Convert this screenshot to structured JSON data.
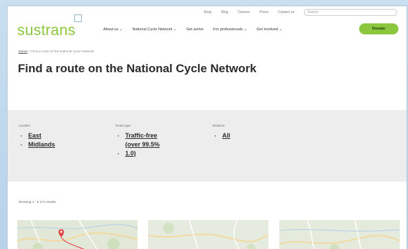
{
  "utility": {
    "links": [
      "Shop",
      "Blog",
      "Careers",
      "Press",
      "Contact us"
    ],
    "search_placeholder": "Search"
  },
  "header": {
    "logo_text": "sustrans",
    "nav": [
      "About us ⌄",
      "National Cycle Network ⌄",
      "Get active",
      "For professionals ⌄",
      "Get involved ⌄"
    ],
    "donate_label": "Donate"
  },
  "breadcrumb": {
    "home": "Home",
    "separator": ">",
    "current": "Find a route on the National Cycle Network"
  },
  "page": {
    "title": "Find a route on the National Cycle Network"
  },
  "filters": {
    "location": {
      "label": "Location",
      "values": [
        "East",
        "Midlands"
      ]
    },
    "route_type": {
      "label": "Route type",
      "values": [
        "Traffic-free",
        "(over 99.5%",
        "1.0)"
      ]
    },
    "distance": {
      "label": "Distance",
      "values": [
        "All"
      ]
    }
  },
  "results": {
    "count_text": "Showing 1 - 6 of 6 results",
    "cards": [
      {
        "name": "route-map-1",
        "has_pin": true
      },
      {
        "name": "route-map-2",
        "has_pin": false
      },
      {
        "name": "route-map-3",
        "has_pin": false
      }
    ]
  },
  "colors": {
    "brand_green": "#8cc63f",
    "filter_panel": "#ededed",
    "page_backdrop": "#c9dff0"
  }
}
